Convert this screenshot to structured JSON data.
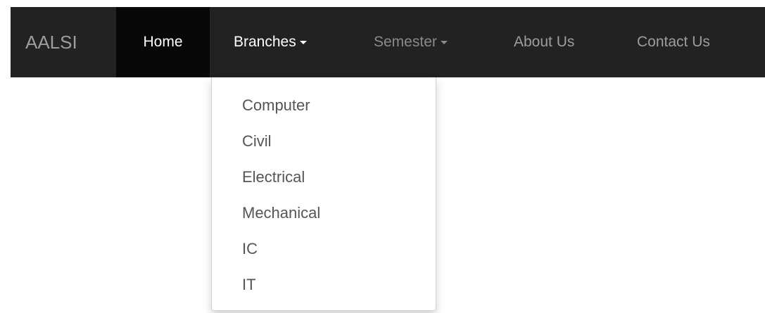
{
  "navbar": {
    "brand": "AALSI",
    "items": [
      {
        "label": "Home"
      },
      {
        "label": "Branches"
      },
      {
        "label": "Semester"
      },
      {
        "label": "About Us"
      },
      {
        "label": "Contact Us"
      }
    ]
  },
  "branches_dropdown": {
    "items": [
      {
        "label": "Computer"
      },
      {
        "label": "Civil"
      },
      {
        "label": "Electrical"
      },
      {
        "label": "Mechanical"
      },
      {
        "label": "IC"
      },
      {
        "label": "IT"
      }
    ]
  },
  "colors": {
    "navbar_bg": "#222222",
    "active_bg": "#080808",
    "muted_text": "#9d9d9d",
    "dropdown_text": "#555555"
  },
  "icons": {
    "dropdown_caret": "caret-down-icon"
  }
}
